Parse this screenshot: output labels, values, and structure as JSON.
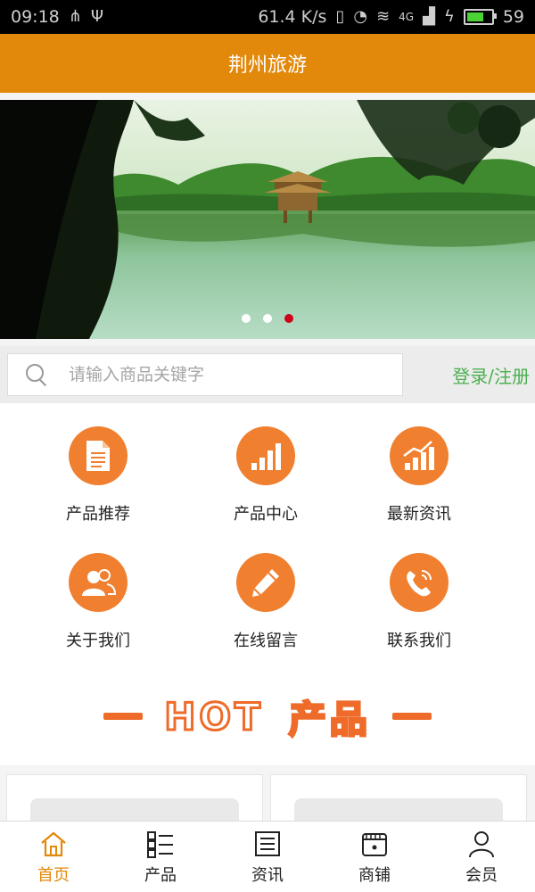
{
  "status_bar": {
    "time": "09:18",
    "speed": "61.4 K/s",
    "battery_level": "59",
    "network": "4G"
  },
  "header": {
    "title": "荆州旅游"
  },
  "banner": {
    "slide_count": 3,
    "active_slide": 3
  },
  "search": {
    "placeholder": "请输入商品关键字",
    "login_label": "登录/注册"
  },
  "menu": {
    "items": [
      {
        "label": "产品推荐",
        "icon": "document-icon"
      },
      {
        "label": "产品中心",
        "icon": "bar-chart-icon"
      },
      {
        "label": "最新资讯",
        "icon": "trend-chart-icon"
      },
      {
        "label": "关于我们",
        "icon": "users-icon"
      },
      {
        "label": "在线留言",
        "icon": "pencil-icon"
      },
      {
        "label": "联系我们",
        "icon": "phone-icon"
      }
    ]
  },
  "hot": {
    "title_en": "HOT",
    "title_cn": "产品"
  },
  "tabbar": {
    "items": [
      {
        "label": "首页",
        "icon": "home-icon",
        "active": true
      },
      {
        "label": "产品",
        "icon": "list-icon",
        "active": false
      },
      {
        "label": "资讯",
        "icon": "news-icon",
        "active": false
      },
      {
        "label": "商铺",
        "icon": "shop-icon",
        "active": false
      },
      {
        "label": "会员",
        "icon": "user-icon",
        "active": false
      }
    ]
  },
  "colors": {
    "header": "#e2880a",
    "accent": "#f08030",
    "hot": "#ee6b2a",
    "login": "#4caf50",
    "active_dot": "#d0021b"
  }
}
